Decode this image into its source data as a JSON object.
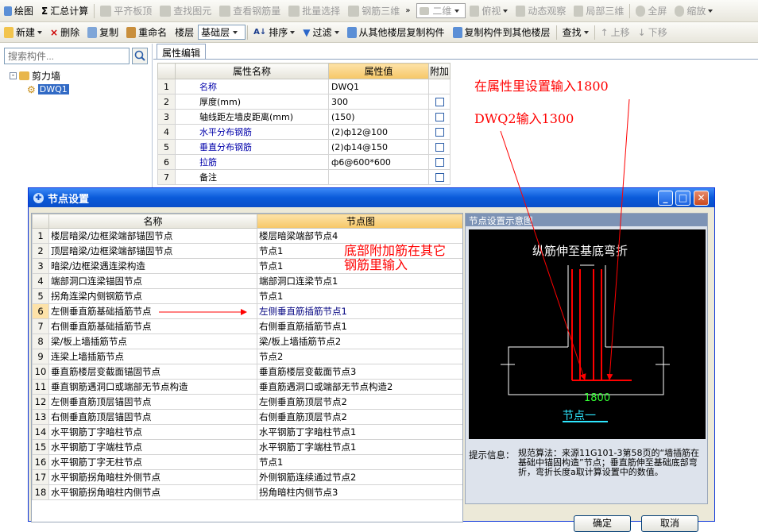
{
  "toolbar1": {
    "items": [
      {
        "label": "绘图",
        "icon": "draw-icon",
        "disabled": false
      },
      {
        "label": "汇总计算",
        "icon": "sigma-icon",
        "disabled": false
      },
      {
        "label": "平齐板顶",
        "icon": "align-slab-icon",
        "disabled": true
      },
      {
        "label": "查找图元",
        "icon": "find-element-icon",
        "disabled": true
      },
      {
        "label": "查看钢筋量",
        "icon": "view-rebar-icon",
        "disabled": true
      },
      {
        "label": "批量选择",
        "icon": "batch-select-icon",
        "disabled": true
      },
      {
        "label": "钢筋三维",
        "icon": "rebar-3d-icon",
        "disabled": true
      }
    ],
    "view_select": "二维",
    "view_items": [
      {
        "label": "俯视",
        "icon": "top-view-icon"
      },
      {
        "label": "动态观察",
        "icon": "orbit-icon"
      },
      {
        "label": "局部三维",
        "icon": "local-3d-icon"
      },
      {
        "label": "全屏",
        "icon": "fullscreen-icon"
      },
      {
        "label": "缩放",
        "icon": "zoom-icon"
      }
    ]
  },
  "toolbar2": {
    "new_label": "新建",
    "delete_label": "删除",
    "copy_label": "复制",
    "rename_label": "重命名",
    "floor_label": "楼层",
    "floor_value": "基础层",
    "sort_label": "排序",
    "filter_label": "过滤",
    "copy_from_floor_label": "从其他楼层复制构件",
    "copy_to_floor_label": "复制构件到其他楼层",
    "find_label": "查找",
    "move_up_label": "上移",
    "move_down_label": "下移"
  },
  "left_panel": {
    "search_placeholder": "搜索构件...",
    "tree_root": "剪力墙",
    "tree_child": "DWQ1"
  },
  "property_panel": {
    "tab_label": "属性编辑",
    "headers": {
      "name": "属性名称",
      "value": "属性值",
      "extra": "附加"
    },
    "rows": [
      {
        "num": "1",
        "name": "名称",
        "value": "DWQ1",
        "blue": true,
        "checkbox": false
      },
      {
        "num": "2",
        "name": "厚度(mm)",
        "value": "300",
        "blue": false,
        "checkbox": true
      },
      {
        "num": "3",
        "name": "轴线距左墙皮距离(mm)",
        "value": "(150)",
        "blue": false,
        "checkbox": true
      },
      {
        "num": "4",
        "name": "水平分布钢筋",
        "value": "(2)ф12@100",
        "blue": true,
        "checkbox": true
      },
      {
        "num": "5",
        "name": "垂直分布钢筋",
        "value": "(2)ф14@150",
        "blue": true,
        "checkbox": true
      },
      {
        "num": "6",
        "name": "拉筋",
        "value": "ф6@600*600",
        "blue": true,
        "checkbox": true
      },
      {
        "num": "7",
        "name": "备注",
        "value": "",
        "blue": false,
        "checkbox": true
      }
    ]
  },
  "annotations": {
    "note1": "在属性里设置输入1800",
    "note2": "DWQ2输入1300",
    "note3_line1": "底部附加筋在其它",
    "note3_line2": "钢筋里输入"
  },
  "dialog": {
    "title": "节点设置",
    "headers": {
      "name": "名称",
      "node": "节点图"
    },
    "rows": [
      {
        "num": "1",
        "name": "楼层暗梁/边框梁端部锚固节点",
        "node": "楼层暗梁端部节点4"
      },
      {
        "num": "2",
        "name": "顶层暗梁/边框梁端部锚固节点",
        "node": "节点1"
      },
      {
        "num": "3",
        "name": "暗梁/边框梁遇连梁构造",
        "node": "节点1"
      },
      {
        "num": "4",
        "name": "端部洞口连梁锚固节点",
        "node": "端部洞口连梁节点1"
      },
      {
        "num": "5",
        "name": "拐角连梁内侧钢筋节点",
        "node": "节点1"
      },
      {
        "num": "6",
        "name": "左侧垂直筋基础插筋节点",
        "node": "左侧垂直筋插筋节点1"
      },
      {
        "num": "7",
        "name": "右侧垂直筋基础插筋节点",
        "node": "右侧垂直筋插筋节点1"
      },
      {
        "num": "8",
        "name": "梁/板上墙插筋节点",
        "node": "梁/板上墙插筋节点2"
      },
      {
        "num": "9",
        "name": "连梁上墙插筋节点",
        "node": "节点2"
      },
      {
        "num": "10",
        "name": "垂直筋楼层变截面锚固节点",
        "node": "垂直筋楼层变截面节点3"
      },
      {
        "num": "11",
        "name": "垂直钢筋遇洞口或端部无节点构造",
        "node": "垂直筋遇洞口或端部无节点构造2"
      },
      {
        "num": "12",
        "name": "左侧垂直筋顶层锚固节点",
        "node": "左侧垂直筋顶层节点2"
      },
      {
        "num": "13",
        "name": "右侧垂直筋顶层锚固节点",
        "node": "右侧垂直筋顶层节点2"
      },
      {
        "num": "14",
        "name": "水平钢筋丁字暗柱节点",
        "node": "水平钢筋丁字暗柱节点1"
      },
      {
        "num": "15",
        "name": "水平钢筋丁字端柱节点",
        "node": "水平钢筋丁字端柱节点1"
      },
      {
        "num": "16",
        "name": "水平钢筋丁字无柱节点",
        "node": "节点1"
      },
      {
        "num": "17",
        "name": "水平钢筋拐角暗柱外侧节点",
        "node": "外侧钢筋连续通过节点2"
      },
      {
        "num": "18",
        "name": "水平钢筋拐角暗柱内侧节点",
        "node": "拐角暗柱内侧节点3"
      }
    ],
    "selected_row": "6",
    "diagram": {
      "title": "节点设置示意图",
      "label": "纵筋伸至基底弯折",
      "dim": "1800",
      "node": "节点一"
    },
    "tip_label": "提示信息：",
    "tip_text": "规范算法：来源11G101-3第58页的“墙插筋在基础中锚固构造”节点；垂直筋伸至基础底部弯折，弯折长度a取计算设置中的数值。",
    "ok_label": "确定",
    "cancel_label": "取消"
  },
  "colors": {
    "annotation": "#ff0000",
    "title_bar": "#0a5ad9",
    "header_highlight": "#f6c766",
    "diagram_bg": "#000000"
  }
}
